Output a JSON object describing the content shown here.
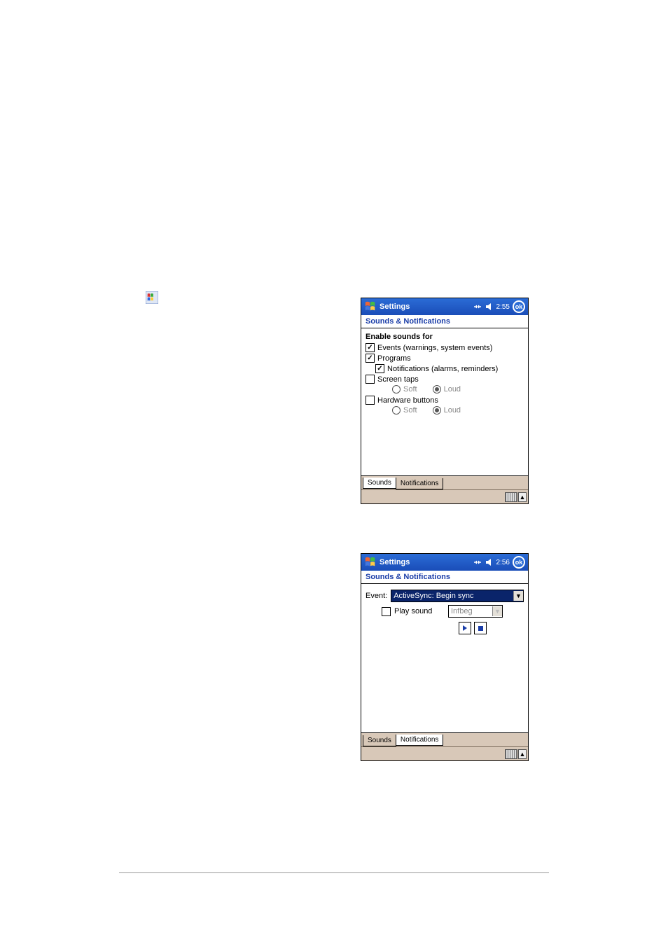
{
  "icons": {
    "start_button_name": "windows-start-icon"
  },
  "screen1": {
    "title": "Settings",
    "time": "2:55",
    "ok": "ok",
    "header": "Sounds & Notifications",
    "group_title": "Enable sounds for",
    "events_label": "Events (warnings, system events)",
    "programs_label": "Programs",
    "notifications_label": "Notifications (alarms, reminders)",
    "screentaps_label": "Screen taps",
    "hardware_label": "Hardware buttons",
    "soft_label": "Soft",
    "loud_label": "Loud",
    "tab_sounds": "Sounds",
    "tab_notifications": "Notifications",
    "checks": {
      "events": true,
      "programs": true,
      "notifications": true,
      "screentaps": false,
      "hardware": false
    },
    "radios": {
      "screentaps": "Loud",
      "hardware": "Loud"
    }
  },
  "screen2": {
    "title": "Settings",
    "time": "2:56",
    "ok": "ok",
    "header": "Sounds & Notifications",
    "event_label": "Event:",
    "event_value": "ActiveSync: Begin sync",
    "playsound_label": "Play sound",
    "playsound_checked": false,
    "sound_name": "Infbeg",
    "tab_sounds": "Sounds",
    "tab_notifications": "Notifications"
  }
}
